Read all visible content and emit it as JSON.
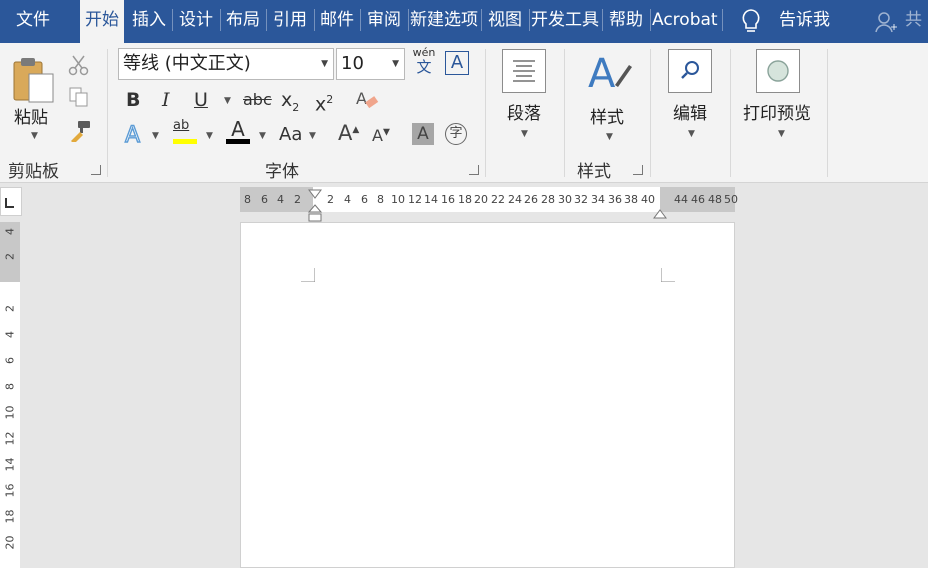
{
  "tabs": [
    {
      "label": "文件",
      "active": false
    },
    {
      "label": "开始",
      "active": true
    },
    {
      "label": "插入",
      "active": false
    },
    {
      "label": "设计",
      "active": false
    },
    {
      "label": "布局",
      "active": false
    },
    {
      "label": "引用",
      "active": false
    },
    {
      "label": "邮件",
      "active": false
    },
    {
      "label": "审阅",
      "active": false
    },
    {
      "label": "新建选项",
      "active": false
    },
    {
      "label": "视图",
      "active": false
    },
    {
      "label": "开发工具",
      "active": false
    },
    {
      "label": "帮助",
      "active": false
    },
    {
      "label": "Acrobat",
      "active": false
    }
  ],
  "tell_me": "告诉我",
  "share": "共",
  "clipboard": {
    "paste_label": "粘贴",
    "group_label": "剪贴板"
  },
  "font": {
    "font_name": "等线 (中文正文)",
    "font_size": "10",
    "group_label": "字体",
    "bold": "B",
    "italic": "I",
    "underline": "U",
    "strike": "abc",
    "subscript_base": "x",
    "subscript": "2",
    "superscript_base": "x",
    "superscript": "2",
    "phonetic_top": "wén",
    "phonetic_bottom": "文",
    "border_char": "A",
    "highlight": "ab",
    "font_color": "A",
    "change_case": "Aa",
    "grow_font": "A",
    "shrink_font": "A",
    "shading": "A",
    "enclose": "字"
  },
  "paragraph": {
    "label": "段落"
  },
  "styles": {
    "label": "样式",
    "group_label": "样式"
  },
  "editing": {
    "label": "编辑"
  },
  "print_preview": {
    "label": "打印预览"
  },
  "ruler_h": [
    "8",
    "6",
    "4",
    "2",
    "2",
    "4",
    "6",
    "8",
    "10",
    "12",
    "14",
    "16",
    "18",
    "20",
    "22",
    "24",
    "26",
    "28",
    "30",
    "32",
    "34",
    "36",
    "38",
    "40",
    "44",
    "46",
    "48",
    "50"
  ],
  "ruler_v": [
    "4",
    "2",
    "2",
    "4",
    "6",
    "8",
    "10",
    "12",
    "14",
    "16",
    "18",
    "20"
  ],
  "colors": {
    "brand": "#2b579a",
    "highlight": "#ffff00",
    "font_color": "#000000",
    "text_effect": "#5b9bd5"
  }
}
